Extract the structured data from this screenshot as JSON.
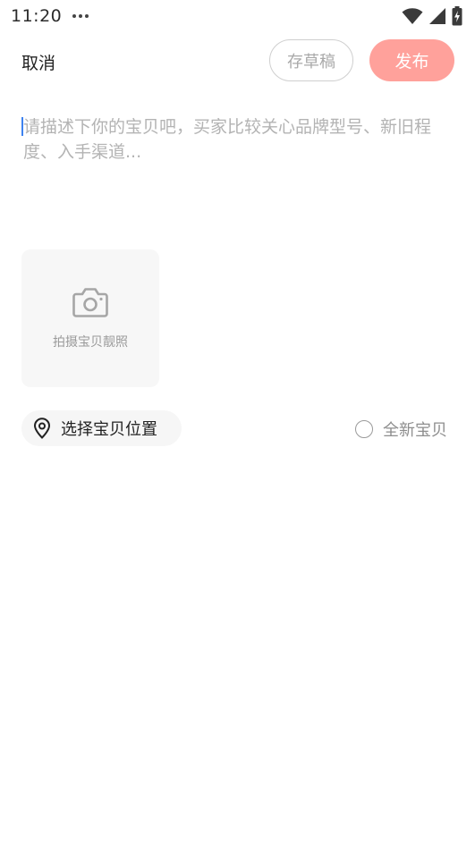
{
  "status_bar": {
    "time": "11:20"
  },
  "header": {
    "cancel_label": "取消",
    "draft_label": "存草稿",
    "publish_label": "发布"
  },
  "description": {
    "placeholder": "请描述下你的宝贝吧，买家比较关心品牌型号、新旧程度、入手渠道..."
  },
  "photo": {
    "label": "拍摄宝贝靓照",
    "icon": "camera-icon"
  },
  "location": {
    "label": "选择宝贝位置",
    "icon": "location-pin-icon"
  },
  "new_item": {
    "label": "全新宝贝",
    "checked": false
  },
  "colors": {
    "publish_bg": "#ffa19b",
    "caret": "#3d82f0",
    "placeholder": "#b3b3b3"
  }
}
